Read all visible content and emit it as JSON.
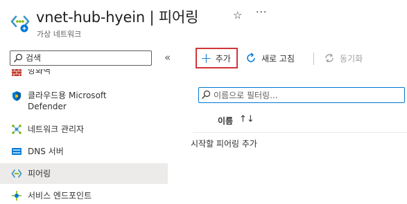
{
  "header": {
    "title": "vnet-hub-hyein | 피어링",
    "subtitle": "가상 네트워크",
    "star_icon": "star-icon",
    "more_label": "···"
  },
  "sidebar": {
    "search_placeholder": "검색",
    "collapse_label": "«",
    "items": [
      {
        "label": "방화벽",
        "icon": "firewall-icon"
      },
      {
        "label": "클라우드용 Microsoft",
        "label2": "Defender",
        "icon": "defender-shield-icon"
      },
      {
        "label": "네트워크 관리자",
        "icon": "network-manager-icon"
      },
      {
        "label": "DNS 서버",
        "icon": "dns-server-icon"
      },
      {
        "label": "피어링",
        "icon": "peering-icon",
        "active": true
      },
      {
        "label": "서비스 엔드포인트",
        "icon": "service-endpoint-icon"
      }
    ]
  },
  "toolbar": {
    "add_label": "추가",
    "refresh_label": "새로 고침",
    "sync_label": "동기화"
  },
  "filter": {
    "placeholder": "이름으로 필터링..."
  },
  "table": {
    "columns": [
      "이름"
    ],
    "sort_icon": "↑↓",
    "empty_message": "시작할 피어링 추가"
  },
  "colors": {
    "accent": "#0078d4",
    "highlight_border": "#d13438",
    "active_bg": "#edebe9"
  }
}
